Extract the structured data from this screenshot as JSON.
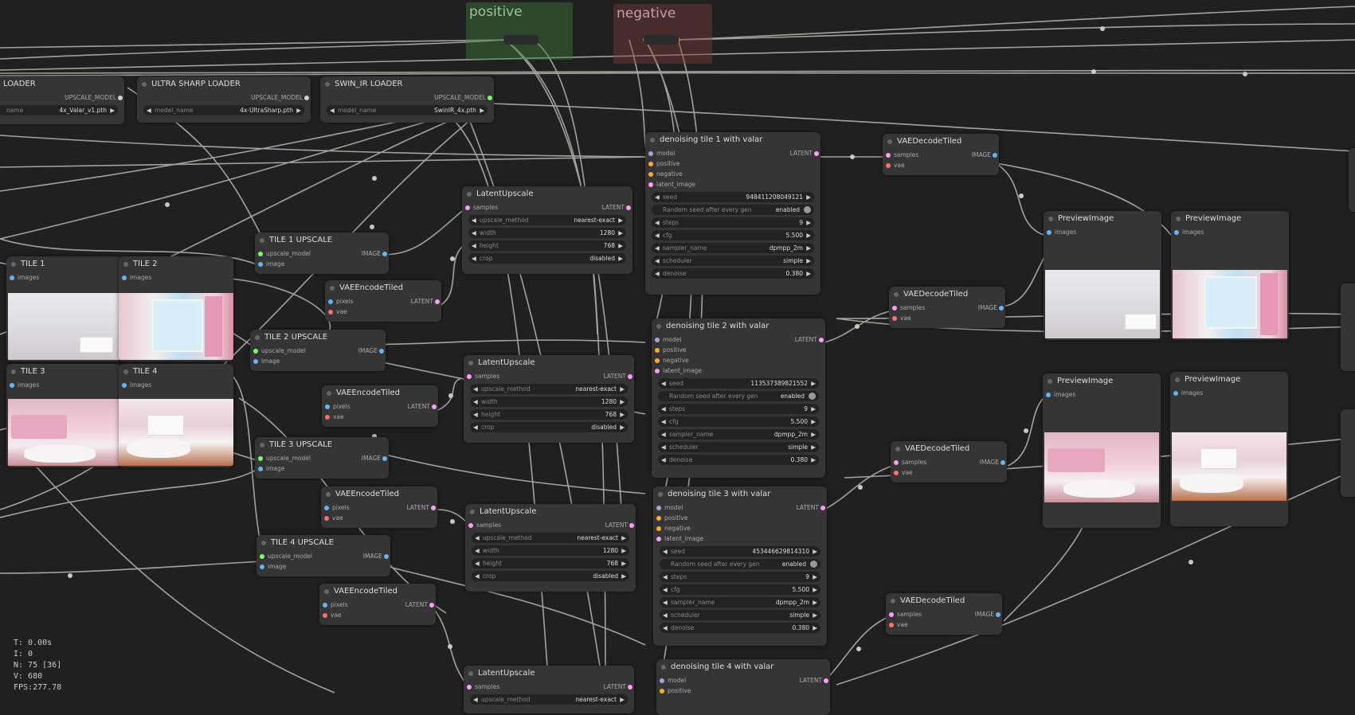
{
  "groups": {
    "positive": "positive",
    "negative": "negative"
  },
  "loaders": [
    {
      "title": "LOADER",
      "output": "UPSCALE_MODEL",
      "field": "name",
      "value": "4x_Valar_v1.pth"
    },
    {
      "title": "ULTRA SHARP LOADER",
      "output": "UPSCALE_MODEL",
      "field": "model_name",
      "value": "4x-UltraSharp.pth"
    },
    {
      "title": "SWIN_IR LOADER",
      "output": "UPSCALE_MODEL",
      "field": "model_name",
      "value": "SwinIR_4x.pth"
    }
  ],
  "tiles": [
    {
      "title": "TILE 1",
      "input": "images"
    },
    {
      "title": "TILE 2",
      "input": "images"
    },
    {
      "title": "TILE 3",
      "input": "images"
    },
    {
      "title": "TILE 4",
      "input": "images"
    }
  ],
  "tile_upscales": [
    {
      "title": "TILE 1 UPSCALE",
      "in1": "upscale_model",
      "in2": "image",
      "output": "IMAGE"
    },
    {
      "title": "TILE 2 UPSCALE",
      "in1": "upscale_model",
      "in2": "image",
      "output": "IMAGE"
    },
    {
      "title": "TILE 3 UPSCALE",
      "in1": "upscale_model",
      "in2": "image",
      "output": "IMAGE"
    },
    {
      "title": "TILE 4 UPSCALE",
      "in1": "upscale_model",
      "in2": "image",
      "output": "IMAGE"
    }
  ],
  "vae_encodes": [
    {
      "title": "VAEEncodeTiled",
      "in1": "pixels",
      "in2": "vae",
      "output": "LATENT"
    },
    {
      "title": "VAEEncodeTiled",
      "in1": "pixels",
      "in2": "vae",
      "output": "LATENT"
    },
    {
      "title": "VAEEncodeTiled",
      "in1": "pixels",
      "in2": "vae",
      "output": "LATENT"
    },
    {
      "title": "VAEEncodeTiled",
      "in1": "pixels",
      "in2": "vae",
      "output": "LATENT"
    }
  ],
  "latent_upscales": [
    {
      "title": "LatentUpscale",
      "input": "samples",
      "output": "LATENT",
      "widgets": [
        {
          "label": "upscale_method",
          "value": "nearest-exact"
        },
        {
          "label": "width",
          "value": "1280"
        },
        {
          "label": "height",
          "value": "768"
        },
        {
          "label": "crop",
          "value": "disabled"
        }
      ]
    },
    {
      "title": "LatentUpscale",
      "input": "samples",
      "output": "LATENT",
      "widgets": [
        {
          "label": "upscale_method",
          "value": "nearest-exact"
        },
        {
          "label": "width",
          "value": "1280"
        },
        {
          "label": "height",
          "value": "768"
        },
        {
          "label": "crop",
          "value": "disabled"
        }
      ]
    },
    {
      "title": "LatentUpscale",
      "input": "samples",
      "output": "LATENT",
      "widgets": [
        {
          "label": "upscale_method",
          "value": "nearest-exact"
        },
        {
          "label": "width",
          "value": "1280"
        },
        {
          "label": "height",
          "value": "768"
        },
        {
          "label": "crop",
          "value": "disabled"
        }
      ]
    },
    {
      "title": "LatentUpscale",
      "input": "samples",
      "output": "LATENT",
      "widgets": [
        {
          "label": "upscale_method",
          "value": "nearest-exact"
        }
      ]
    }
  ],
  "samplers": [
    {
      "title": "denoising tile 1 with valar",
      "output": "LATENT",
      "inputs": [
        "model",
        "positive",
        "negative",
        "latent_image"
      ],
      "seed": "948411208049121",
      "random_label": "Random seed after every gen",
      "random_value": "enabled",
      "widgets": [
        {
          "label": "steps",
          "value": "9"
        },
        {
          "label": "cfg",
          "value": "5.500"
        },
        {
          "label": "sampler_name",
          "value": "dpmpp_2m"
        },
        {
          "label": "scheduler",
          "value": "simple"
        },
        {
          "label": "denoise",
          "value": "0.380"
        }
      ]
    },
    {
      "title": "denoising tile 2 with valar",
      "output": "LATENT",
      "inputs": [
        "model",
        "positive",
        "negative",
        "latent_image"
      ],
      "seed": "113537389821552",
      "random_label": "Random seed after every gen",
      "random_value": "enabled",
      "widgets": [
        {
          "label": "steps",
          "value": "9"
        },
        {
          "label": "cfg",
          "value": "5.500"
        },
        {
          "label": "sampler_name",
          "value": "dpmpp_2m"
        },
        {
          "label": "scheduler",
          "value": "simple"
        },
        {
          "label": "denoise",
          "value": "0.380"
        }
      ]
    },
    {
      "title": "denoising tile 3 with valar",
      "output": "LATENT",
      "inputs": [
        "model",
        "positive",
        "negative",
        "latent_image"
      ],
      "seed": "453446629814310",
      "random_label": "Random seed after every gen",
      "random_value": "enabled",
      "widgets": [
        {
          "label": "steps",
          "value": "9"
        },
        {
          "label": "cfg",
          "value": "5.500"
        },
        {
          "label": "sampler_name",
          "value": "dpmpp_2m"
        },
        {
          "label": "scheduler",
          "value": "simple"
        },
        {
          "label": "denoise",
          "value": "0.380"
        }
      ]
    },
    {
      "title": "denoising tile 4 with valar",
      "output": "LATENT",
      "inputs": [
        "model",
        "positive"
      ]
    }
  ],
  "vae_decodes": [
    {
      "title": "VAEDecodeTiled",
      "in1": "samples",
      "in2": "vae",
      "output": "IMAGE"
    },
    {
      "title": "VAEDecodeTiled",
      "in1": "samples",
      "in2": "vae",
      "output": "IMAGE"
    },
    {
      "title": "VAEDecodeTiled",
      "in1": "samples",
      "in2": "vae",
      "output": "IMAGE"
    },
    {
      "title": "VAEDecodeTiled",
      "in1": "samples",
      "in2": "vae",
      "output": "IMAGE"
    }
  ],
  "previews": [
    {
      "title": "PreviewImage",
      "input": "images"
    },
    {
      "title": "PreviewImage",
      "input": "images"
    },
    {
      "title": "PreviewImage",
      "input": "images"
    },
    {
      "title": "PreviewImage",
      "input": "images"
    }
  ],
  "stats": {
    "t": "T: 0.00s",
    "i": "I: 0",
    "n": "N: 75 [36]",
    "v": "V: 680",
    "fps": "FPS:277.78"
  },
  "colors": {
    "background": "#202020",
    "node": "#353535",
    "wire": "#b4b8b0",
    "latent": "#ff9cf9",
    "image": "#64b5f6",
    "vae": "#ff6e6e"
  }
}
